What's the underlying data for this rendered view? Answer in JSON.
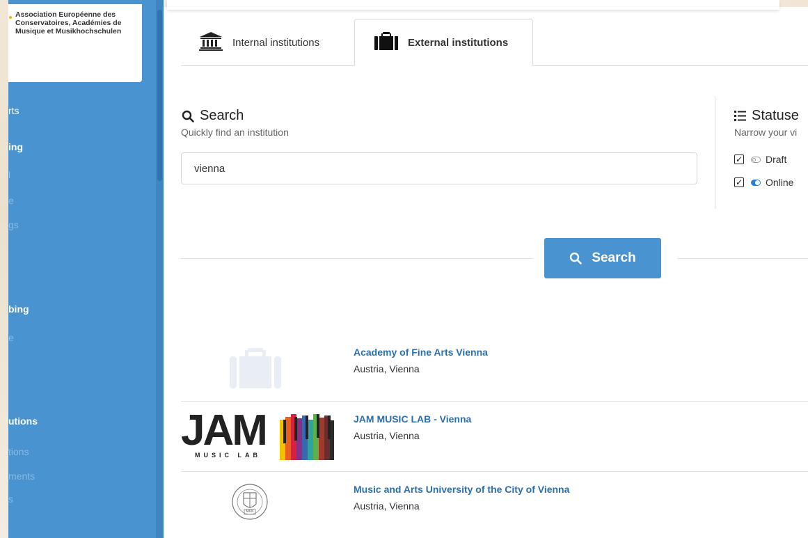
{
  "sidebar": {
    "logo_lines": [
      "Association Européenne des",
      "Conservatoires, Académies de",
      "Musique et Musikhochschulen"
    ],
    "items": [
      {
        "label": "rts",
        "style": "plain"
      },
      {
        "label": "ing",
        "style": "head"
      },
      {
        "label": "l",
        "style": "sub"
      },
      {
        "label": "e",
        "style": "sub"
      },
      {
        "label": "gs",
        "style": "sub"
      },
      {
        "label": "bing",
        "style": "head"
      },
      {
        "label": "e",
        "style": "sub"
      },
      {
        "label": "utions",
        "style": "head"
      },
      {
        "label": "tions",
        "style": "sub"
      },
      {
        "label": "ments",
        "style": "sub"
      },
      {
        "label": "s",
        "style": "sub"
      }
    ]
  },
  "tabs": {
    "internal": {
      "label": "Internal institutions",
      "icon": "institution-icon"
    },
    "external": {
      "label": "External institutions",
      "icon": "briefcase-icon",
      "active": true
    }
  },
  "search": {
    "title": "Search",
    "subtitle": "Quickly find an institution",
    "query": "vienna",
    "button_label": "Search"
  },
  "statuses": {
    "title": "Statuse",
    "subtitle": "Narrow your vi",
    "options": [
      {
        "label": "Draft",
        "checked": true,
        "toggle": "off"
      },
      {
        "label": "Online",
        "checked": true,
        "toggle": "on"
      }
    ]
  },
  "results": [
    {
      "name": "Academy of Fine Arts Vienna",
      "location": "Austria, Vienna",
      "logo": "placeholder-briefcase"
    },
    {
      "name": "JAM MUSIC LAB - Vienna",
      "location": "Austria, Vienna",
      "logo": "jam-music-lab",
      "logo_text": "JAM",
      "logo_subtext": "MUSIC LAB"
    },
    {
      "name": "Music and Arts University of the City of Vienna",
      "location": "Austria, Vienna",
      "logo": "muk-seal",
      "logo_text": "MUK"
    }
  ],
  "colors": {
    "sidebar": "#4a93d1",
    "link": "#2a6fb0",
    "button": "#4a93d1",
    "toggle_on": "#2a7fd4"
  }
}
